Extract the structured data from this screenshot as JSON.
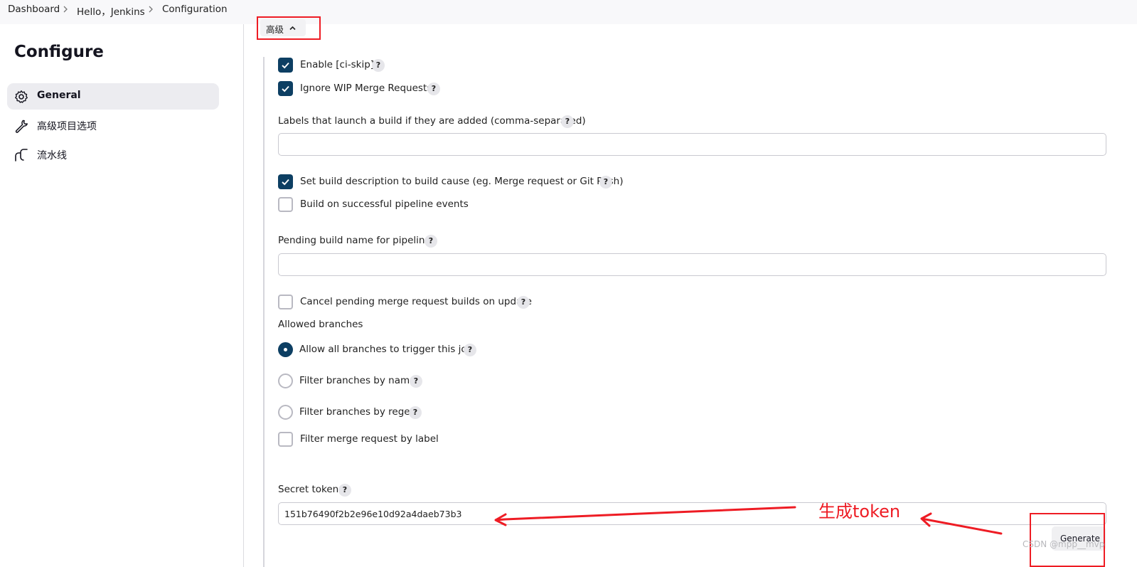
{
  "breadcrumb": {
    "items": [
      "Dashboard",
      "Hello，Jenkins",
      "Configuration"
    ]
  },
  "sidebar": {
    "title": "Configure",
    "items": [
      {
        "label": "General",
        "icon": "gear-icon",
        "active": true
      },
      {
        "label": "高级项目选项",
        "icon": "wrench-icon",
        "active": false
      },
      {
        "label": "流水线",
        "icon": "pipeline-icon",
        "active": false
      }
    ]
  },
  "advanced": {
    "toggle_label": "高级",
    "enable_ci_skip": {
      "label": "Enable [ci-skip]",
      "checked": true
    },
    "ignore_wip": {
      "label": "Ignore WIP Merge Requests",
      "checked": true
    },
    "labels_field": {
      "label": "Labels that launch a build if they are added (comma-separated)",
      "value": ""
    },
    "set_build_description": {
      "label": "Set build description to build cause (eg. Merge request or Git Push)",
      "checked": true
    },
    "build_on_pipeline": {
      "label": "Build on successful pipeline events",
      "checked": false
    },
    "pending_build_name": {
      "label": "Pending build name for pipeline",
      "value": ""
    },
    "cancel_pending": {
      "label": "Cancel pending merge request builds on update",
      "checked": false
    },
    "allowed_branches": {
      "label": "Allowed branches",
      "options": [
        {
          "label": "Allow all branches to trigger this job",
          "selected": true
        },
        {
          "label": "Filter branches by name",
          "selected": false
        },
        {
          "label": "Filter branches by regex",
          "selected": false
        }
      ]
    },
    "filter_by_label": {
      "label": "Filter merge request by label",
      "checked": false
    },
    "secret_token": {
      "label": "Secret token",
      "value": "151b76490f2b2e96e10d92a4daeb73b3"
    },
    "generate_label": "Generate",
    "help_glyph": "?"
  },
  "annotation": {
    "text": "生成token",
    "color": "#ee1c24"
  },
  "watermark": "CSDN @mpp__mvp",
  "colors": {
    "accent": "#0d3f63",
    "annotation_red": "#ee1c24"
  }
}
